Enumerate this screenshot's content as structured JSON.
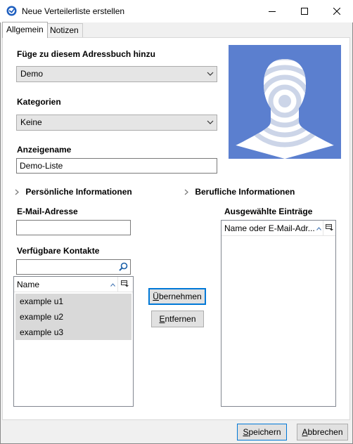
{
  "window": {
    "title": "Neue Verteilerliste erstellen"
  },
  "tabs": [
    {
      "label": "Allgemein",
      "active": true
    },
    {
      "label": "Notizen",
      "active": false
    }
  ],
  "form": {
    "addressbook_label": "Füge zu diesem Adressbuch hinzu",
    "addressbook_value": "Demo",
    "categories_label": "Kategorien",
    "categories_value": "Keine",
    "displayname_label": "Anzeigename",
    "displayname_value": "Demo-Liste",
    "personal_toggle": "Persönliche Informationen",
    "business_toggle": "Berufliche Informationen",
    "email_label": "E-Mail-Adresse",
    "email_value": "",
    "available_label": "Verfügbare Kontakte",
    "available_search_value": "",
    "selected_label": "Ausgewählte Einträge"
  },
  "available_list": {
    "column": "Name",
    "rows": [
      "example u1",
      "example u2",
      "example u3"
    ]
  },
  "selected_list": {
    "column": "Name oder E-Mail-Adr..."
  },
  "buttons": {
    "apply_first": "Ü",
    "apply_rest": "bernehmen",
    "remove_first": "E",
    "remove_rest": "ntfernen",
    "save_first": "S",
    "save_rest": "peichern",
    "cancel_first": "A",
    "cancel_rest": "bbrechen"
  },
  "colors": {
    "avatar_bg": "#5b7fcf",
    "avatar_rings": "#ccd5e8",
    "focus_blue": "#0078d7"
  },
  "icons": [
    "app-icon",
    "minimize-icon",
    "maximize-icon",
    "close-icon",
    "chevron-down-icon",
    "chevron-right-icon",
    "search-icon",
    "sort-up-icon",
    "column-picker-icon",
    "avatar-placeholder"
  ]
}
